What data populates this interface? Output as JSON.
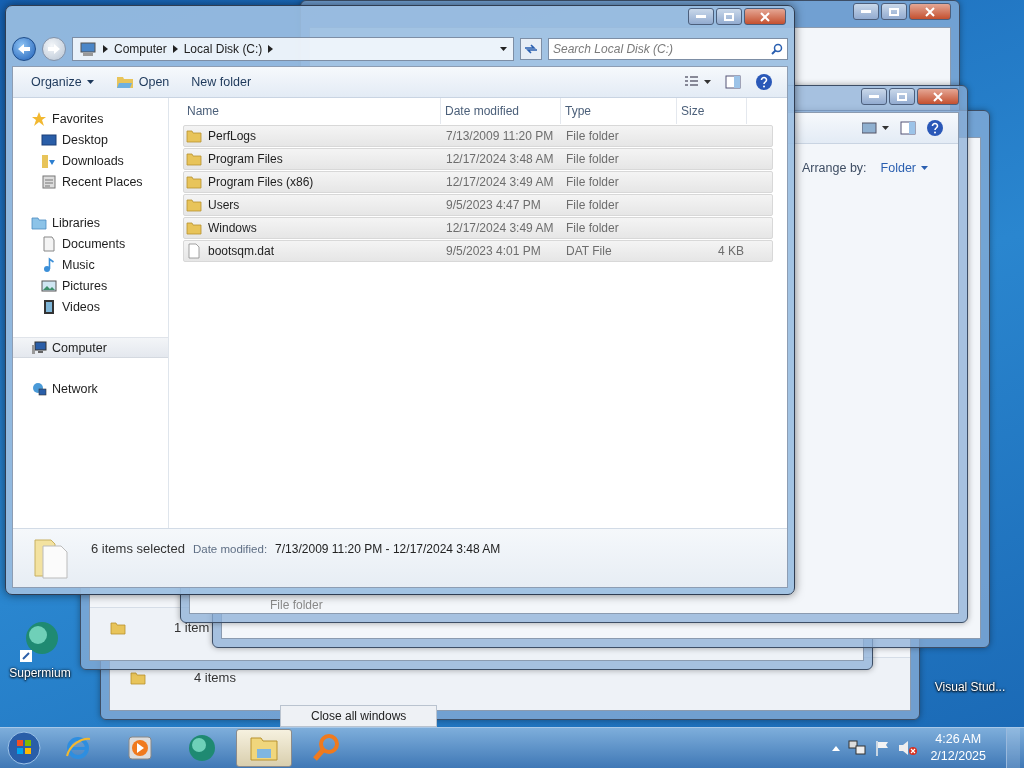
{
  "desktop_icons": [
    {
      "label": "Supermium",
      "kind": "browser"
    },
    {
      "label": "Visual Stud...",
      "kind": "plain"
    }
  ],
  "background_windows": [
    {
      "kind": "titled"
    },
    {
      "kind": "status",
      "status_text": "4 items"
    },
    {
      "kind": "status",
      "status_text": "1 item"
    },
    {
      "kind": "plain"
    },
    {
      "kind": "arrange",
      "arrange_label": "Arrange by:",
      "arrange_value": "Folder",
      "row_text": "File folder"
    }
  ],
  "explorer": {
    "breadcrumb": [
      "Computer",
      "Local Disk (C:)"
    ],
    "search_placeholder": "Search Local Disk (C:)",
    "toolbar": [
      {
        "label": "Organize",
        "kind": "menu"
      },
      {
        "label": "Open",
        "kind": "open"
      },
      {
        "label": "New folder",
        "kind": "plain"
      }
    ],
    "nav": [
      {
        "label": "Favorites",
        "kind": "star",
        "selected": false,
        "children": [
          {
            "label": "Desktop",
            "kind": "desktop",
            "selected": false
          },
          {
            "label": "Downloads",
            "kind": "downloads",
            "selected": false
          },
          {
            "label": "Recent Places",
            "kind": "recent",
            "selected": false
          }
        ]
      },
      {
        "label": "Libraries",
        "kind": "libraries",
        "selected": false,
        "children": [
          {
            "label": "Documents",
            "kind": "documents",
            "selected": false
          },
          {
            "label": "Music",
            "kind": "music",
            "selected": false
          },
          {
            "label": "Pictures",
            "kind": "pictures",
            "selected": false
          },
          {
            "label": "Videos",
            "kind": "videos",
            "selected": false
          }
        ]
      },
      {
        "label": "Computer",
        "kind": "computer",
        "selected": true
      },
      {
        "label": "Network",
        "kind": "network",
        "selected": false
      }
    ],
    "columns": [
      "Name",
      "Date modified",
      "Type",
      "Size"
    ],
    "rows": [
      {
        "name": "PerfLogs",
        "kind": "folder",
        "date": "7/13/2009 11:20 PM",
        "type": "File folder",
        "selected": true
      },
      {
        "name": "Program Files",
        "kind": "folder",
        "date": "12/17/2024 3:48 AM",
        "type": "File folder",
        "selected": true
      },
      {
        "name": "Program Files (x86)",
        "kind": "folder",
        "date": "12/17/2024 3:49 AM",
        "type": "File folder",
        "selected": true
      },
      {
        "name": "Users",
        "kind": "folder",
        "date": "9/5/2023 4:47 PM",
        "type": "File folder",
        "selected": true
      },
      {
        "name": "Windows",
        "kind": "folder",
        "date": "12/17/2024 3:49 AM",
        "type": "File folder",
        "selected": true
      },
      {
        "name": "bootsqm.dat",
        "kind": "file",
        "date": "9/5/2023 4:01 PM",
        "type": "DAT File",
        "size": "4 KB",
        "selected": true
      }
    ],
    "status": {
      "count": "6 items selected",
      "date_label": "Date modified:",
      "date_range": "7/13/2009 11:20 PM - 12/17/2024 3:48 AM"
    }
  },
  "taskbar": {
    "apps": [
      {
        "kind": "ie",
        "active": false
      },
      {
        "kind": "media",
        "active": false
      },
      {
        "kind": "browser",
        "active": false
      },
      {
        "kind": "explorer",
        "active": true
      },
      {
        "kind": "search",
        "active": false
      }
    ],
    "tooltip": "Close all windows",
    "time": "4:26 AM",
    "date": "2/12/2025"
  }
}
